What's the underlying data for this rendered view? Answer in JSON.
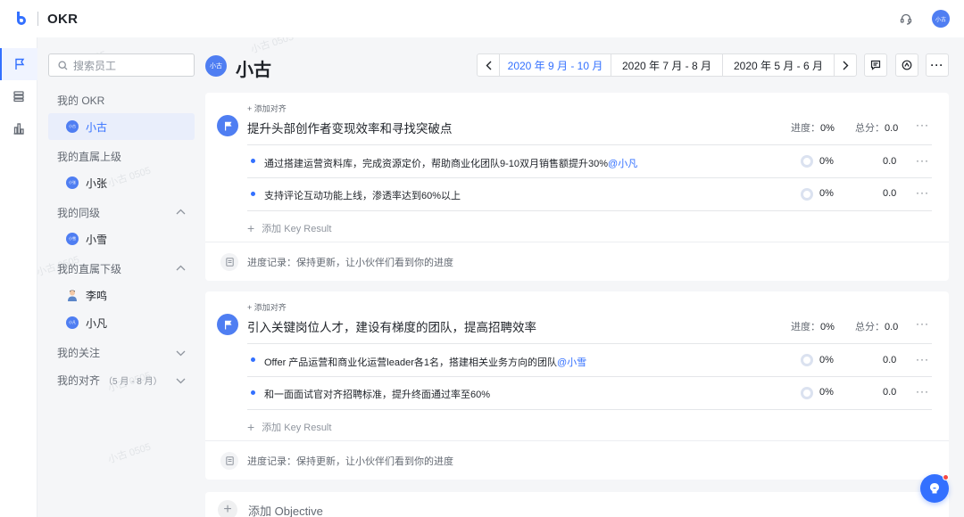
{
  "app": {
    "title": "OKR"
  },
  "header": {
    "user_avatar": "小古"
  },
  "sidebar": {
    "search_placeholder": "搜索员工",
    "sections": {
      "my_okr": "我的 OKR",
      "superior": "我的直属上级",
      "peers": "我的同级",
      "subordinates": "我的直属下级",
      "following": "我的关注",
      "alignment": "我的对齐",
      "alignment_period": "（5 月 - 8 月）"
    },
    "users": {
      "me": {
        "name": "小古",
        "avatar": "小古"
      },
      "superior": {
        "name": "小张",
        "avatar": "小张"
      },
      "peer": {
        "name": "小雪",
        "avatar": "小雪"
      },
      "sub1": {
        "name": "李鸣"
      },
      "sub2": {
        "name": "小凡",
        "avatar": "小凡"
      }
    }
  },
  "main": {
    "user": {
      "name": "小古",
      "avatar": "小古"
    },
    "periods": [
      "2020 年 9 月 - 10 月",
      "2020 年 7 月 - 8 月",
      "2020 年 5 月 - 6 月"
    ],
    "current_period_index": 0
  },
  "objectives": [
    {
      "align_label": "+ 添加对齐",
      "title": "提升头部创作者变现效率和寻找突破点",
      "progress_label": "进度：",
      "progress": "0%",
      "score_label": "总分：",
      "score": "0.0",
      "key_results": [
        {
          "text": "通过搭建运营资料库，完成资源定价，帮助商业化团队9-10双月销售额提升30%",
          "mention": "@小凡",
          "progress": "0%",
          "score": "0.0"
        },
        {
          "text": "支持评论互动功能上线，渗透率达到60%以上",
          "mention": "",
          "progress": "0%",
          "score": "0.0"
        }
      ],
      "add_kr": "添加 Key Result",
      "progress_record": "进度记录：保持更新，让小伙伴们看到你的进度"
    },
    {
      "align_label": "+ 添加对齐",
      "title": "引入关键岗位人才，建设有梯度的团队，提高招聘效率",
      "progress_label": "进度：",
      "progress": "0%",
      "score_label": "总分：",
      "score": "0.0",
      "key_results": [
        {
          "text": "Offer 产品运营和商业化运营leader各1名，搭建相关业务方向的团队",
          "mention": "@小雪",
          "progress": "0%",
          "score": "0.0"
        },
        {
          "text": "和一面面试官对齐招聘标准，提升终面通过率至60%",
          "mention": "",
          "progress": "0%",
          "score": "0.0"
        }
      ],
      "add_kr": "添加 Key Result",
      "progress_record": "进度记录：保持更新，让小伙伴们看到你的进度"
    }
  ],
  "add_objective": "添加 Objective",
  "watermark": "小古 0505",
  "colors": {
    "accent": "#3370ff",
    "avatar": "#4f7ef2",
    "text": "#1f2329",
    "muted": "#646a73"
  },
  "icons": [
    "logo-icon",
    "headset-icon",
    "flag-icon",
    "list-icon",
    "chart-icon",
    "search-icon",
    "chevron-up-icon",
    "chevron-down-icon",
    "chevron-left-icon",
    "chevron-right-icon",
    "comment-icon",
    "share-icon",
    "more-icon",
    "document-icon",
    "plus-icon",
    "help-icon"
  ]
}
